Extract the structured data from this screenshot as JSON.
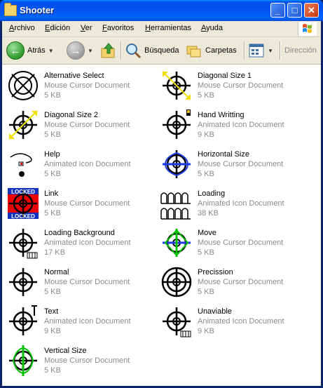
{
  "window": {
    "title": "Shooter"
  },
  "title_buttons": [
    {
      "label": "_",
      "icon": "minimize-icon"
    },
    {
      "label": "□",
      "icon": "maximize-icon"
    },
    {
      "label": "✕",
      "icon": "close-icon"
    }
  ],
  "menu": [
    "Archivo",
    "Edición",
    "Ver",
    "Favoritos",
    "Herramientas",
    "Ayuda"
  ],
  "toolbar": {
    "back_label": "Atrás",
    "search_label": "Búsqueda",
    "folders_label": "Carpetas",
    "address_label": "Dirección"
  },
  "files": [
    {
      "name": "Alternative Select",
      "type": "Mouse Cursor Document",
      "size": "5 KB",
      "icon": "alternative-select-cursor-icon"
    },
    {
      "name": "Diagonal Size 1",
      "type": "Mouse Cursor Document",
      "size": "5 KB",
      "icon": "diagonal-size-1-cursor-icon"
    },
    {
      "name": "Diagonal Size 2",
      "type": "Mouse Cursor Document",
      "size": "5 KB",
      "icon": "diagonal-size-2-cursor-icon"
    },
    {
      "name": "Hand Writting",
      "type": "Animated Icon Document",
      "size": "9 KB",
      "icon": "hand-writting-cursor-icon"
    },
    {
      "name": "Help",
      "type": "Animated Icon Document",
      "size": "5 KB",
      "icon": "help-cursor-icon"
    },
    {
      "name": "Horizontal Size",
      "type": "Mouse Cursor Document",
      "size": "5 KB",
      "icon": "horizontal-size-cursor-icon"
    },
    {
      "name": "Link",
      "type": "Mouse Cursor Document",
      "size": "5 KB",
      "icon": "link-cursor-icon",
      "badge": "LOCKED"
    },
    {
      "name": "Loading",
      "type": "Animated Icon Document",
      "size": "38 KB",
      "icon": "loading-cursor-icon"
    },
    {
      "name": "Loading Background",
      "type": "Animated Icon Document",
      "size": "17 KB",
      "icon": "loading-background-cursor-icon"
    },
    {
      "name": "Move",
      "type": "Mouse Cursor Document",
      "size": "5 KB",
      "icon": "move-cursor-icon"
    },
    {
      "name": "Normal",
      "type": "Mouse Cursor Document",
      "size": "5 KB",
      "icon": "normal-cursor-icon"
    },
    {
      "name": "Precission",
      "type": "Mouse Cursor Document",
      "size": "5 KB",
      "icon": "precission-cursor-icon"
    },
    {
      "name": "Text",
      "type": "Animated Icon Document",
      "size": "9 KB",
      "icon": "text-cursor-icon"
    },
    {
      "name": "Unaviable",
      "type": "Animated Icon Document",
      "size": "9 KB",
      "icon": "unaviable-cursor-icon"
    },
    {
      "name": "Vertical Size",
      "type": "Mouse Cursor Document",
      "size": "5 KB",
      "icon": "vertical-size-cursor-icon"
    }
  ]
}
